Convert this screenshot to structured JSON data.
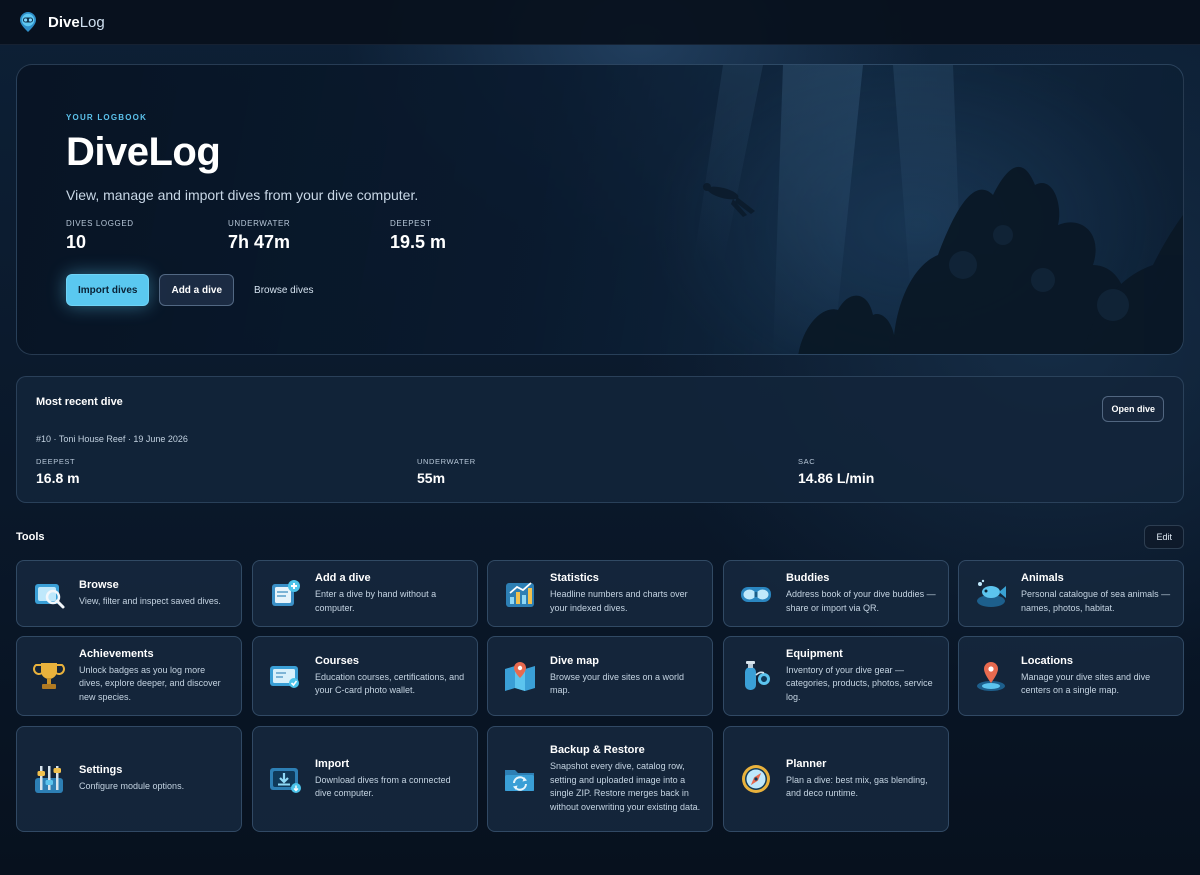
{
  "app": {
    "brand_bold": "Dive",
    "brand_light": "Log",
    "logo_icon": "scuba-mask-icon"
  },
  "hero": {
    "eyebrow": "YOUR LOGBOOK",
    "title": "DiveLog",
    "subtitle": "View, manage and import dives from your dive computer.",
    "stats": [
      {
        "label": "DIVES LOGGED",
        "value": "10"
      },
      {
        "label": "UNDERWATER",
        "value": "7h 47m"
      },
      {
        "label": "DEEPEST",
        "value": "19.5 m"
      }
    ],
    "actions": {
      "import": "Import dives",
      "add": "Add a dive",
      "browse": "Browse dives"
    }
  },
  "recent": {
    "title": "Most recent dive",
    "meta": "#10 · Toni House Reef · 19 June 2026",
    "open_label": "Open dive",
    "stats": [
      {
        "label": "DEEPEST",
        "value": "16.8 m"
      },
      {
        "label": "UNDERWATER",
        "value": "55m"
      },
      {
        "label": "SAC",
        "value": "14.86 L/min"
      }
    ]
  },
  "tools": {
    "heading": "Tools",
    "edit_label": "Edit",
    "items": [
      {
        "title": "Browse",
        "desc": "View, filter and inspect saved dives.",
        "icon": "logbook-search-icon"
      },
      {
        "title": "Add a dive",
        "desc": "Enter a dive by hand without a computer.",
        "icon": "clipboard-add-icon"
      },
      {
        "title": "Statistics",
        "desc": "Headline numbers and charts over your indexed dives.",
        "icon": "bar-chart-icon"
      },
      {
        "title": "Buddies",
        "desc": "Address book of your dive buddies — share or import via QR.",
        "icon": "dive-mask-icon"
      },
      {
        "title": "Animals",
        "desc": "Personal catalogue of sea animals — names, photos, habitat.",
        "icon": "fish-icon"
      },
      {
        "title": "Achievements",
        "desc": "Unlock badges as you log more dives, explore deeper, and discover new species.",
        "icon": "trophy-icon"
      },
      {
        "title": "Courses",
        "desc": "Education courses, certifications, and your C-card photo wallet.",
        "icon": "certificate-card-icon"
      },
      {
        "title": "Dive map",
        "desc": "Browse your dive sites on a world map.",
        "icon": "map-pin-icon"
      },
      {
        "title": "Equipment",
        "desc": "Inventory of your dive gear — categories, products, photos, service log.",
        "icon": "scuba-tank-icon"
      },
      {
        "title": "Locations",
        "desc": "Manage your dive sites and dive centers on a single map.",
        "icon": "location-marker-icon"
      },
      {
        "title": "Settings",
        "desc": "Configure module options.",
        "icon": "sliders-icon"
      },
      {
        "title": "Import",
        "desc": "Download dives from a connected dive computer.",
        "icon": "download-icon"
      },
      {
        "title": "Backup & Restore",
        "desc": "Snapshot every dive, catalog row, setting and uploaded image into a single ZIP. Restore merges back in without overwriting your existing data.",
        "icon": "folder-sync-icon"
      },
      {
        "title": "Planner",
        "desc": "Plan a dive: best mix, gas blending, and deco runtime.",
        "icon": "compass-icon"
      }
    ]
  }
}
